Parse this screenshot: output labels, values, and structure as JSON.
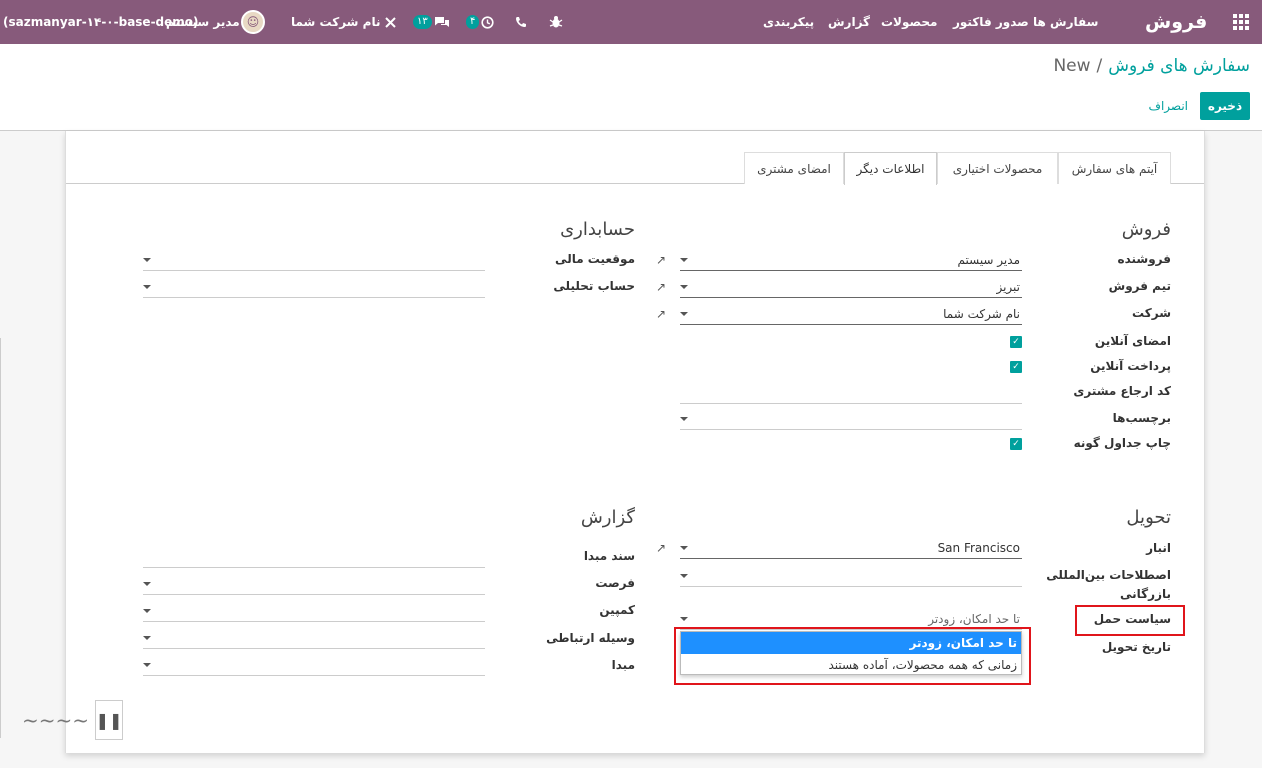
{
  "navbar": {
    "app_title": "فروش",
    "menu": [
      "سفارش ها",
      "صدور فاکتور",
      "محصولات",
      "گزارش",
      "پیکربندی"
    ],
    "user_name": "مدیر سیستم",
    "db_name": "(sazmanyar-۱۴-۰-base-demo)",
    "company": "نام شرکت شما",
    "activities_count": "۴",
    "messages_count": "۱۳",
    "color": "#875A7B"
  },
  "breadcrumb": {
    "parent": "سفارش های فروش",
    "separator": "/",
    "current": "New"
  },
  "buttons": {
    "save": "ذخیره",
    "discard": "انصراف"
  },
  "tabs": [
    "آیتم های سفارش",
    "محصولات اختیاری",
    "اطلاعات دیگر",
    "امضای مشتری"
  ],
  "active_tab": "اطلاعات دیگر",
  "sales": {
    "title": "فروش",
    "salesperson_label": "فروشنده",
    "salesperson_value": "مدیر سیستم",
    "team_label": "تیم فروش",
    "team_value": "تبریز",
    "company_label": "شرکت",
    "company_value": "نام شرکت شما",
    "online_signature_label": "امضای آنلاین",
    "online_payment_label": "پرداخت آنلاین",
    "customer_ref_label": "کد ارجاع مشتری",
    "tags_label": "برچسب‌ها",
    "print_grid_label": "چاپ جداول گونه"
  },
  "accounting": {
    "title": "حسابداری",
    "fiscal_position_label": "موقعیت مالی",
    "analytic_account_label": "حساب تحلیلی"
  },
  "delivery": {
    "title": "تحویل",
    "warehouse_label": "انبار",
    "warehouse_value": "San Francisco",
    "incoterm_label_1": "اصطلاحات بین‌المللی",
    "incoterm_label_2": "بازرگانی",
    "shipping_policy_label": "سیاست حمل",
    "shipping_policy_value": "تا حد امکان، زودتر",
    "delivery_date_label": "تاریخ تحویل"
  },
  "shipping_policy_options": [
    "تا حد امکان، زودتر",
    "زمانی که همه محصولات، آماده هستند"
  ],
  "report": {
    "title": "گزارش",
    "source_doc_label": "سند مبدا",
    "opportunity_label": "فرصت",
    "campaign_label": "کمپین",
    "medium_label": "وسیله ارتباطی",
    "source_label": "مبدا"
  },
  "highlight_color": "#E0151B",
  "accent_color": "#00A09D"
}
